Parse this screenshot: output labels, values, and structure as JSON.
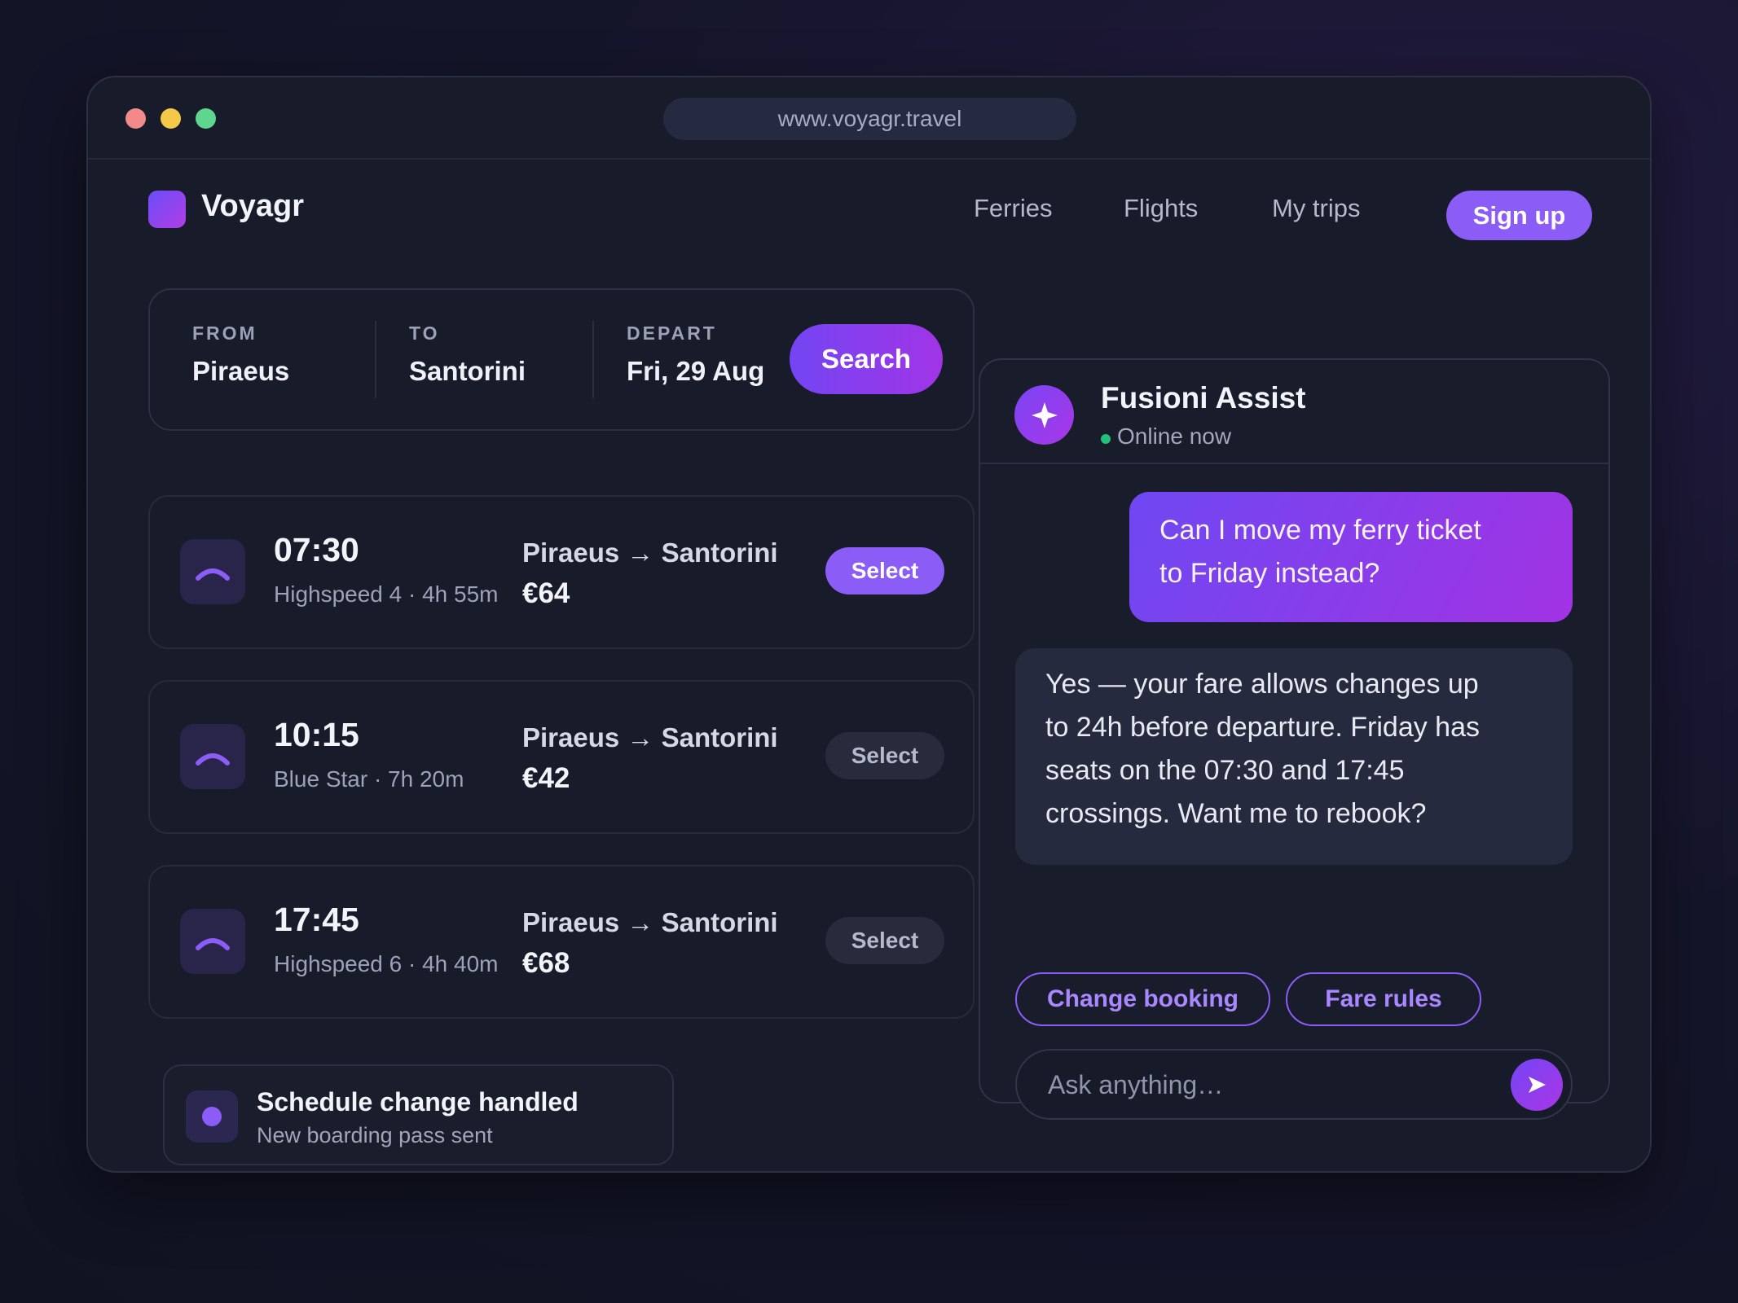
{
  "browser": {
    "url": "www.voyagr.travel"
  },
  "header": {
    "brand": "Voyagr",
    "nav": [
      {
        "label": "Ferries"
      },
      {
        "label": "Flights"
      },
      {
        "label": "My trips"
      }
    ],
    "signup_label": "Sign up",
    "accent_color": "#8b5cf6"
  },
  "search": {
    "from_label": "FROM",
    "from_value": "Piraeus",
    "to_label": "TO",
    "to_value": "Santorini",
    "depart_label": "DEPART",
    "depart_value": "Fri, 29 Aug",
    "button_label": "Search"
  },
  "trips": [
    {
      "time": "07:30",
      "details": "Highspeed 4 · 4h 55m",
      "route": "Piraeus → Santorini",
      "price": "€64",
      "select_label": "Select",
      "icon": "ferry-icon",
      "selected": true
    },
    {
      "time": "10:15",
      "details": "Blue Star · 7h 20m",
      "route": "Piraeus → Santorini",
      "price": "€42",
      "select_label": "Select",
      "icon": "ferry-icon",
      "selected": false
    },
    {
      "time": "17:45",
      "details": "Highspeed 6 · 4h 40m",
      "route": "Piraeus → Santorini",
      "price": "€68",
      "select_label": "Select",
      "icon": "ferry-icon",
      "selected": false
    }
  ],
  "toast": {
    "title": "Schedule change handled",
    "subtitle": "New boarding pass sent"
  },
  "assistant": {
    "name": "Fusioni Assist",
    "status": "Online now",
    "status_color": "#22c07a",
    "avatar_icon": "sparkle-icon",
    "messages": [
      {
        "from": "user",
        "lines": [
          "Can I move my ferry ticket",
          "to Friday instead?"
        ]
      },
      {
        "from": "assistant",
        "lines": [
          "Yes — your fare allows changes up",
          "to 24h before departure. Friday has",
          "seats on the 07:30 and 17:45",
          "crossings. Want me to rebook?"
        ]
      }
    ],
    "quick_replies": [
      {
        "label": "Change booking"
      },
      {
        "label": "Fare rules"
      }
    ],
    "input_placeholder": "Ask anything…",
    "send_icon": "send-icon"
  }
}
